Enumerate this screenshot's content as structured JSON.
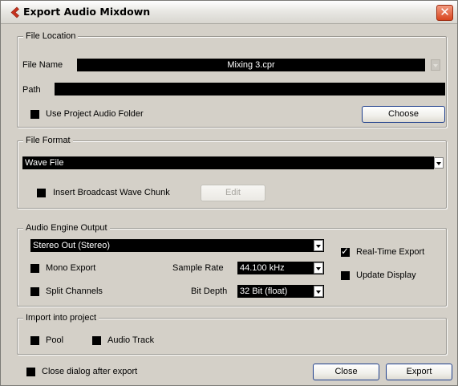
{
  "window": {
    "title": "Export Audio Mixdown",
    "app_icon": "cubase-chevron-icon",
    "close_glyph": "✕"
  },
  "file_location": {
    "legend": "File Location",
    "file_name_label": "File Name",
    "file_name_value": "Mixing 3.cpr",
    "path_label": "Path",
    "path_value": "",
    "use_project_folder_label": "Use Project Audio Folder",
    "use_project_folder_checked": false,
    "choose_label": "Choose"
  },
  "file_format": {
    "legend": "File Format",
    "format_value": "Wave File",
    "broadcast_label": "Insert Broadcast Wave Chunk",
    "broadcast_checked": false,
    "edit_label": "Edit"
  },
  "audio_engine": {
    "legend": "Audio Engine Output",
    "output_value": "Stereo Out (Stereo)",
    "mono_export_label": "Mono Export",
    "mono_export_checked": false,
    "split_channels_label": "Split Channels",
    "split_channels_checked": false,
    "sample_rate_label": "Sample Rate",
    "sample_rate_value": "44.100 kHz",
    "bit_depth_label": "Bit Depth",
    "bit_depth_value": "32 Bit (float)",
    "realtime_label": "Real-Time Export",
    "realtime_checked": true,
    "update_display_label": "Update Display",
    "update_display_checked": false
  },
  "import": {
    "legend": "Import into project",
    "pool_label": "Pool",
    "pool_checked": false,
    "audio_track_label": "Audio Track",
    "audio_track_checked": false
  },
  "footer": {
    "close_after_label": "Close dialog after export",
    "close_after_checked": false,
    "close_label": "Close",
    "export_label": "Export"
  },
  "colors": {
    "dialog_bg": "#d4d0c8",
    "field_bg": "#000000",
    "field_text": "#ffffff",
    "icon_red": "#c8321e",
    "close_red": "#d8451e"
  }
}
